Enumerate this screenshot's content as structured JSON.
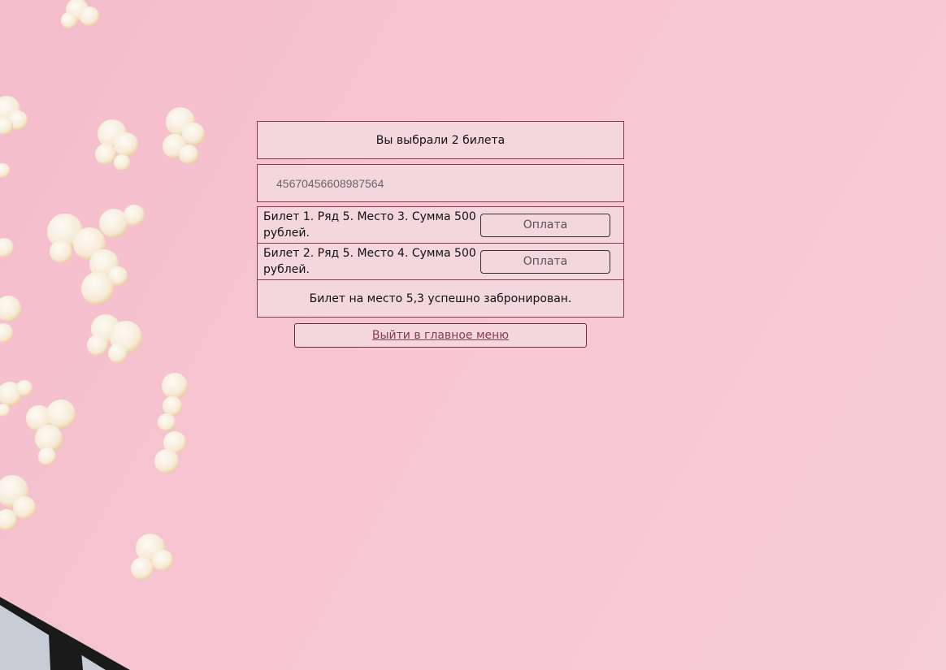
{
  "header": {
    "title": "Вы выбрали 2 билета"
  },
  "card": {
    "number": "45670456608987564"
  },
  "tickets": [
    {
      "description": "Билет 1. Ряд 5. Место 3. Сумма 500 рублей.",
      "pay_label": "Оплата"
    },
    {
      "description": "Билет 2. Ряд 5. Место 4. Сумма 500 рублей.",
      "pay_label": "Оплата"
    }
  ],
  "status": {
    "message": "Билет на место 5,3 успешно забронирован."
  },
  "footer": {
    "main_menu_label": "Выйти в главное меню"
  },
  "colors": {
    "background": "#f6c4d0",
    "panel": "#f3d6de",
    "border": "#8b3a52"
  }
}
